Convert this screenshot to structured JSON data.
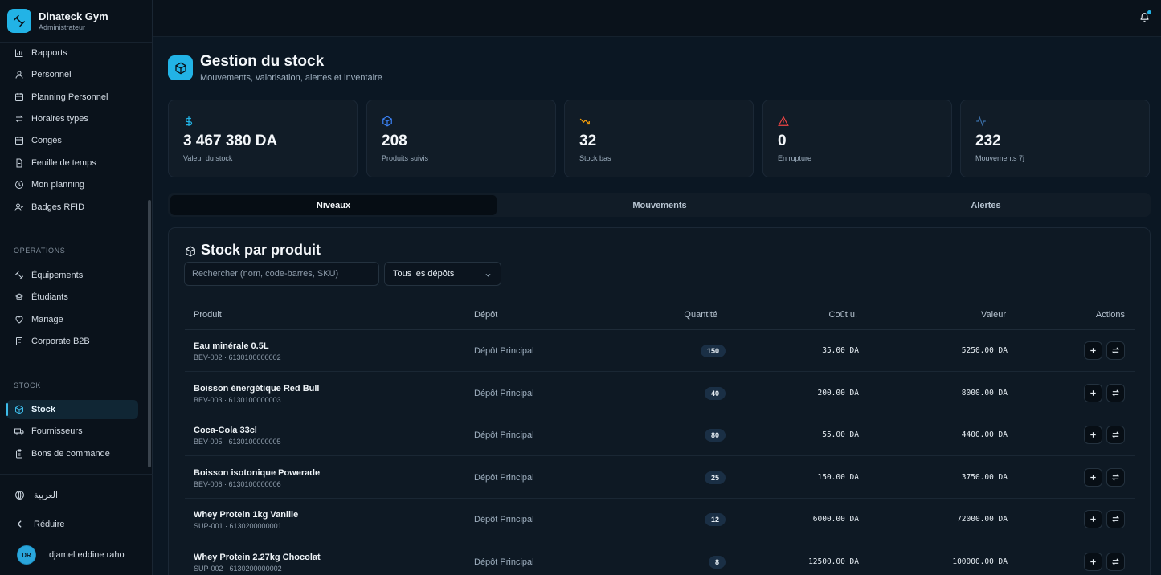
{
  "app": {
    "name": "Dinateck Gym",
    "role": "Administrateur"
  },
  "sidebar": {
    "items_top": [
      {
        "label": "Rapports",
        "icon": "bar-chart-icon"
      },
      {
        "label": "Personnel",
        "icon": "user-icon"
      },
      {
        "label": "Planning Personnel",
        "icon": "calendar-icon"
      },
      {
        "label": "Horaires types",
        "icon": "swap-icon"
      },
      {
        "label": "Congés",
        "icon": "calendar-icon"
      },
      {
        "label": "Feuille de temps",
        "icon": "file-icon"
      },
      {
        "label": "Mon planning",
        "icon": "clock-icon"
      },
      {
        "label": "Badges RFID",
        "icon": "user-check-icon"
      }
    ],
    "section_operations": "OPÉRATIONS",
    "items_operations": [
      {
        "label": "Équipements",
        "icon": "dumbbell-icon"
      },
      {
        "label": "Étudiants",
        "icon": "graduation-cap-icon"
      },
      {
        "label": "Mariage",
        "icon": "heart-icon"
      },
      {
        "label": "Corporate B2B",
        "icon": "building-icon"
      }
    ],
    "section_stock": "STOCK",
    "items_stock": [
      {
        "label": "Stock",
        "icon": "box-icon",
        "active": true
      },
      {
        "label": "Fournisseurs",
        "icon": "truck-icon"
      },
      {
        "label": "Bons de commande",
        "icon": "clipboard-icon"
      }
    ],
    "language": "العربية",
    "collapse": "Réduire",
    "user": {
      "initials": "DR",
      "name": "djamel eddine raho"
    }
  },
  "header": {
    "title": "Gestion du stock",
    "subtitle": "Mouvements, valorisation, alertes et inventaire"
  },
  "kpis": [
    {
      "value": "3 467 380 DA",
      "label": "Valeur du stock",
      "icon": "dollar-icon",
      "color": "#22b3e6"
    },
    {
      "value": "208",
      "label": "Produits suivis",
      "icon": "box-icon",
      "color": "#3b82f6"
    },
    {
      "value": "32",
      "label": "Stock bas",
      "icon": "trending-down-icon",
      "color": "#f59e0b"
    },
    {
      "value": "0",
      "label": "En rupture",
      "icon": "alert-triangle-icon",
      "color": "#ef4444"
    },
    {
      "value": "232",
      "label": "Mouvements 7j",
      "icon": "activity-icon",
      "color": "#3b6fa8"
    }
  ],
  "tabs": [
    {
      "label": "Niveaux",
      "active": true
    },
    {
      "label": "Mouvements",
      "active": false
    },
    {
      "label": "Alertes",
      "active": false
    }
  ],
  "stock_card": {
    "title": "Stock par produit",
    "search_placeholder": "Rechercher (nom, code-barres, SKU)",
    "depot_filter": "Tous les dépôts",
    "columns": [
      "Produit",
      "Dépôt",
      "Quantité",
      "Coût u.",
      "Valeur",
      "Actions"
    ],
    "rows": [
      {
        "name": "Eau minérale 0.5L",
        "sku": "BEV-002 · 6130100000002",
        "depot": "Dépôt Principal",
        "qty": "150",
        "cost": "35.00 DA",
        "value": "5250.00 DA"
      },
      {
        "name": "Boisson énergétique Red Bull",
        "sku": "BEV-003 · 6130100000003",
        "depot": "Dépôt Principal",
        "qty": "40",
        "cost": "200.00 DA",
        "value": "8000.00 DA"
      },
      {
        "name": "Coca-Cola 33cl",
        "sku": "BEV-005 · 6130100000005",
        "depot": "Dépôt Principal",
        "qty": "80",
        "cost": "55.00 DA",
        "value": "4400.00 DA"
      },
      {
        "name": "Boisson isotonique Powerade",
        "sku": "BEV-006 · 6130100000006",
        "depot": "Dépôt Principal",
        "qty": "25",
        "cost": "150.00 DA",
        "value": "3750.00 DA"
      },
      {
        "name": "Whey Protein 1kg Vanille",
        "sku": "SUP-001 · 6130200000001",
        "depot": "Dépôt Principal",
        "qty": "12",
        "cost": "6000.00 DA",
        "value": "72000.00 DA"
      },
      {
        "name": "Whey Protein 2.27kg Chocolat",
        "sku": "SUP-002 · 6130200000002",
        "depot": "Dépôt Principal",
        "qty": "8",
        "cost": "12500.00 DA",
        "value": "100000.00 DA"
      }
    ]
  }
}
